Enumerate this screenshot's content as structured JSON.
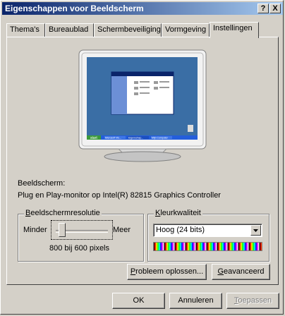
{
  "window": {
    "title": "Eigenschappen voor Beeldscherm"
  },
  "titlebar": {
    "help_label": "?",
    "close_label": "X"
  },
  "tabs": [
    {
      "label": "Thema's"
    },
    {
      "label": "Bureaublad"
    },
    {
      "label": "Schermbeveiliging"
    },
    {
      "label": "Vormgeving"
    },
    {
      "label": "Instellingen"
    }
  ],
  "monitor_preview": {
    "start_label": "start",
    "taskbar_items": [
      "Microsoft Vis...",
      "Eigenschap...",
      "Mijn Computer"
    ]
  },
  "display": {
    "label": "Beeldscherm:",
    "device": "Plug en Play-monitor op Intel(R) 82815 Graphics Controller"
  },
  "resolution": {
    "group_label_first": "B",
    "group_label_rest": "eeldschermresolutie",
    "less_label": "Minder",
    "more_label": "Meer",
    "value_text": "800 bij 600 pixels",
    "slider_position": 0
  },
  "color_quality": {
    "group_label_first": "K",
    "group_label_rest": "leurkwaliteit",
    "selected": "Hoog (24 bits)"
  },
  "buttons": {
    "troubleshoot_first": "P",
    "troubleshoot_rest": "robleem oplossen...",
    "advanced_first": "G",
    "advanced_rest": "eavanceerd",
    "ok": "OK",
    "cancel": "Annuleren",
    "apply_first": "T",
    "apply_rest": "oepassen"
  },
  "colors": {
    "title_active": "#0a246a",
    "desktop": "#3a6ea5",
    "taskbar": "#245edb"
  }
}
